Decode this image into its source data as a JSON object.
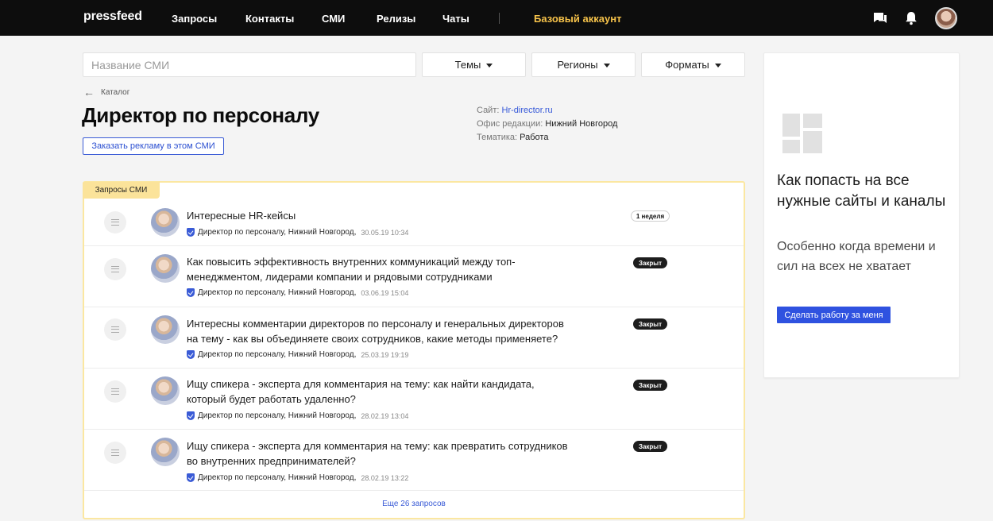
{
  "nav": {
    "logo": "pressfeed",
    "items": [
      "Запросы",
      "Контакты",
      "СМИ",
      "Релизы",
      "Чаты"
    ],
    "account": "Базовый аккаунт",
    "icons": [
      "chat-icon",
      "bell-icon",
      "avatar"
    ]
  },
  "filters": {
    "search_placeholder": "Название СМИ",
    "themes": "Темы",
    "regions": "Регионы",
    "formats": "Форматы"
  },
  "breadcrumb": "Каталог",
  "media": {
    "title": "Директор по персоналу",
    "ad_button": "Заказать рекламу в этом СМИ",
    "site_label": "Сайт:",
    "site_value": "Hr-director.ru",
    "office_label": "Офис редакции:",
    "office_value": "Нижний Новгород",
    "topic_label": "Тематика:",
    "topic_value": "Работа"
  },
  "requests": {
    "tab": "Запросы СМИ",
    "items": [
      {
        "line1": "Интересные HR-кейсы",
        "line2": "",
        "author": "Директор по персоналу, Нижний Новгород,",
        "date": "30.05.19 10:34",
        "badge": "1 неделя",
        "badge_style": "light"
      },
      {
        "line1": "Как повысить эффективность внутренних коммуникаций между топ-",
        "line2": "менеджментом, лидерами компании и рядовыми сотрудниками",
        "author": "Директор по персоналу, Нижний Новгород,",
        "date": "03.06.19 15:04",
        "badge": "Закрыт",
        "badge_style": "dark"
      },
      {
        "line1": "Интересны комментарии директоров по персоналу и генеральных директоров",
        "line2": "на тему - как вы объединяете своих сотрудников, какие методы применяете?",
        "author": "Директор по персоналу, Нижний Новгород,",
        "date": "25.03.19 19:19",
        "badge": "Закрыт",
        "badge_style": "dark"
      },
      {
        "line1": "Ищу спикера - эксперта для комментария на тему: как найти кандидата,",
        "line2": "который будет работать удаленно?",
        "author": "Директор по персоналу, Нижний Новгород,",
        "date": "28.02.19 13:04",
        "badge": "Закрыт",
        "badge_style": "dark"
      },
      {
        "line1": "Ищу спикера - эксперта для комментария на тему: как превратить сотрудников",
        "line2": "во внутренних предпринимателей?",
        "author": "Директор по персоналу, Нижний Новгород,",
        "date": "28.02.19 13:22",
        "badge": "Закрыт",
        "badge_style": "dark"
      }
    ],
    "more": "Еще 26 запросов"
  },
  "promo": {
    "title": "Как попасть на все нужные сайты и каналы",
    "subtitle": "Особенно когда времени и сил на всех не хватает",
    "button": "Сделать работу за меня"
  },
  "colors": {
    "accent": "#2f52e0",
    "account": "#f6c24a",
    "tab": "#fbe39a"
  }
}
